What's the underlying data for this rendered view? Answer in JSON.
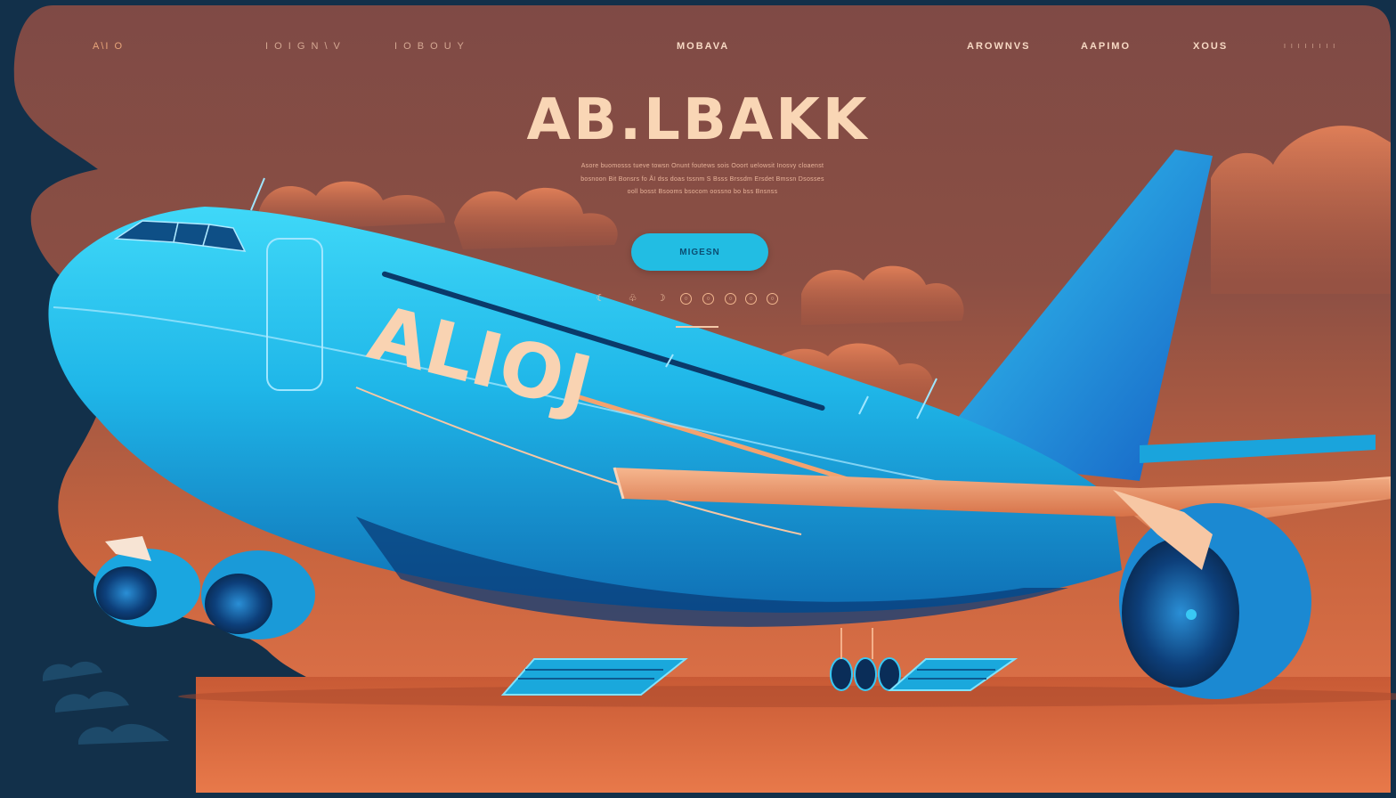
{
  "nav": {
    "logo": "A\\I O",
    "left": [
      "I O I G N \\ V",
      "I O B O U Y"
    ],
    "center": "MOBAVA",
    "right": [
      "AROWNVS",
      "AAPIMO",
      "XOUS"
    ],
    "end": "I I I I I I I I"
  },
  "hero": {
    "title": "AB.LBAKK",
    "description": [
      "Asore buomosss tueve towsn Onunt foutews sois Ooort uelowsit Inosvy cloaenst",
      "bosnoon Bit Bonsrs fo ÅI dss doas tssnm S Bsss Brssdm Ersdet Bmssn Dsosses",
      "ooll bosst Bsooms bsocom oossno bo bss Bnsnss"
    ],
    "cta_label": "MIGESN",
    "aircraft_livery": "ALIOJ"
  },
  "social_icons": [
    {
      "icon": "moon-icon",
      "glyph": "☾"
    },
    {
      "icon": "leaf-icon",
      "glyph": "♧"
    },
    {
      "icon": "crescent-icon",
      "glyph": "☽"
    },
    {
      "icon": "circle-icon-1",
      "glyph": "○"
    },
    {
      "icon": "circle-icon-2",
      "glyph": "○"
    },
    {
      "icon": "circle-icon-3",
      "glyph": "○"
    },
    {
      "icon": "circle-icon-4",
      "glyph": "○"
    },
    {
      "icon": "circle-icon-5",
      "glyph": "○"
    }
  ],
  "colors": {
    "background_dark": "#12304a",
    "panel_top": "#8a5045",
    "panel_bottom": "#e0764c",
    "accent_cyan": "#22bde3",
    "title_cream": "#f9d6b5",
    "aircraft_blue": "#1fb6e8"
  }
}
